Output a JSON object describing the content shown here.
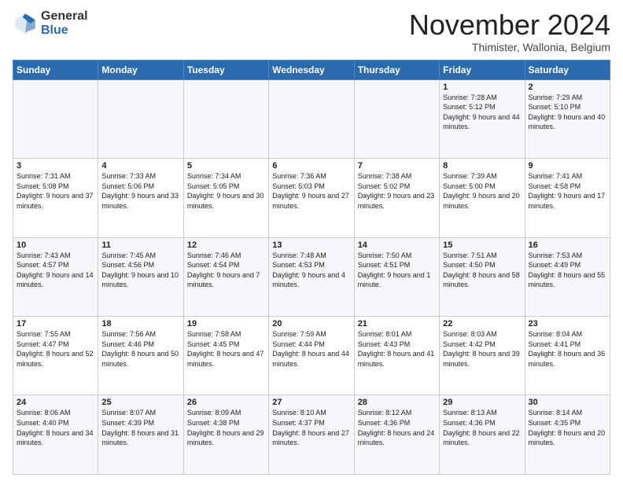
{
  "logo": {
    "general": "General",
    "blue": "Blue"
  },
  "header": {
    "month": "November 2024",
    "location": "Thimister, Wallonia, Belgium"
  },
  "days_of_week": [
    "Sunday",
    "Monday",
    "Tuesday",
    "Wednesday",
    "Thursday",
    "Friday",
    "Saturday"
  ],
  "weeks": [
    [
      {
        "day": "",
        "info": ""
      },
      {
        "day": "",
        "info": ""
      },
      {
        "day": "",
        "info": ""
      },
      {
        "day": "",
        "info": ""
      },
      {
        "day": "",
        "info": ""
      },
      {
        "day": "1",
        "info": "Sunrise: 7:28 AM\nSunset: 5:12 PM\nDaylight: 9 hours and 44 minutes."
      },
      {
        "day": "2",
        "info": "Sunrise: 7:29 AM\nSunset: 5:10 PM\nDaylight: 9 hours and 40 minutes."
      }
    ],
    [
      {
        "day": "3",
        "info": "Sunrise: 7:31 AM\nSunset: 5:08 PM\nDaylight: 9 hours and 37 minutes."
      },
      {
        "day": "4",
        "info": "Sunrise: 7:33 AM\nSunset: 5:06 PM\nDaylight: 9 hours and 33 minutes."
      },
      {
        "day": "5",
        "info": "Sunrise: 7:34 AM\nSunset: 5:05 PM\nDaylight: 9 hours and 30 minutes."
      },
      {
        "day": "6",
        "info": "Sunrise: 7:36 AM\nSunset: 5:03 PM\nDaylight: 9 hours and 27 minutes."
      },
      {
        "day": "7",
        "info": "Sunrise: 7:38 AM\nSunset: 5:02 PM\nDaylight: 9 hours and 23 minutes."
      },
      {
        "day": "8",
        "info": "Sunrise: 7:39 AM\nSunset: 5:00 PM\nDaylight: 9 hours and 20 minutes."
      },
      {
        "day": "9",
        "info": "Sunrise: 7:41 AM\nSunset: 4:58 PM\nDaylight: 9 hours and 17 minutes."
      }
    ],
    [
      {
        "day": "10",
        "info": "Sunrise: 7:43 AM\nSunset: 4:57 PM\nDaylight: 9 hours and 14 minutes."
      },
      {
        "day": "11",
        "info": "Sunrise: 7:45 AM\nSunset: 4:56 PM\nDaylight: 9 hours and 10 minutes."
      },
      {
        "day": "12",
        "info": "Sunrise: 7:46 AM\nSunset: 4:54 PM\nDaylight: 9 hours and 7 minutes."
      },
      {
        "day": "13",
        "info": "Sunrise: 7:48 AM\nSunset: 4:53 PM\nDaylight: 9 hours and 4 minutes."
      },
      {
        "day": "14",
        "info": "Sunrise: 7:50 AM\nSunset: 4:51 PM\nDaylight: 9 hours and 1 minute."
      },
      {
        "day": "15",
        "info": "Sunrise: 7:51 AM\nSunset: 4:50 PM\nDaylight: 8 hours and 58 minutes."
      },
      {
        "day": "16",
        "info": "Sunrise: 7:53 AM\nSunset: 4:49 PM\nDaylight: 8 hours and 55 minutes."
      }
    ],
    [
      {
        "day": "17",
        "info": "Sunrise: 7:55 AM\nSunset: 4:47 PM\nDaylight: 8 hours and 52 minutes."
      },
      {
        "day": "18",
        "info": "Sunrise: 7:56 AM\nSunset: 4:46 PM\nDaylight: 8 hours and 50 minutes."
      },
      {
        "day": "19",
        "info": "Sunrise: 7:58 AM\nSunset: 4:45 PM\nDaylight: 8 hours and 47 minutes."
      },
      {
        "day": "20",
        "info": "Sunrise: 7:59 AM\nSunset: 4:44 PM\nDaylight: 8 hours and 44 minutes."
      },
      {
        "day": "21",
        "info": "Sunrise: 8:01 AM\nSunset: 4:43 PM\nDaylight: 8 hours and 41 minutes."
      },
      {
        "day": "22",
        "info": "Sunrise: 8:03 AM\nSunset: 4:42 PM\nDaylight: 8 hours and 39 minutes."
      },
      {
        "day": "23",
        "info": "Sunrise: 8:04 AM\nSunset: 4:41 PM\nDaylight: 8 hours and 36 minutes."
      }
    ],
    [
      {
        "day": "24",
        "info": "Sunrise: 8:06 AM\nSunset: 4:40 PM\nDaylight: 8 hours and 34 minutes."
      },
      {
        "day": "25",
        "info": "Sunrise: 8:07 AM\nSunset: 4:39 PM\nDaylight: 8 hours and 31 minutes."
      },
      {
        "day": "26",
        "info": "Sunrise: 8:09 AM\nSunset: 4:38 PM\nDaylight: 8 hours and 29 minutes."
      },
      {
        "day": "27",
        "info": "Sunrise: 8:10 AM\nSunset: 4:37 PM\nDaylight: 8 hours and 27 minutes."
      },
      {
        "day": "28",
        "info": "Sunrise: 8:12 AM\nSunset: 4:36 PM\nDaylight: 8 hours and 24 minutes."
      },
      {
        "day": "29",
        "info": "Sunrise: 8:13 AM\nSunset: 4:36 PM\nDaylight: 8 hours and 22 minutes."
      },
      {
        "day": "30",
        "info": "Sunrise: 8:14 AM\nSunset: 4:35 PM\nDaylight: 8 hours and 20 minutes."
      }
    ]
  ]
}
